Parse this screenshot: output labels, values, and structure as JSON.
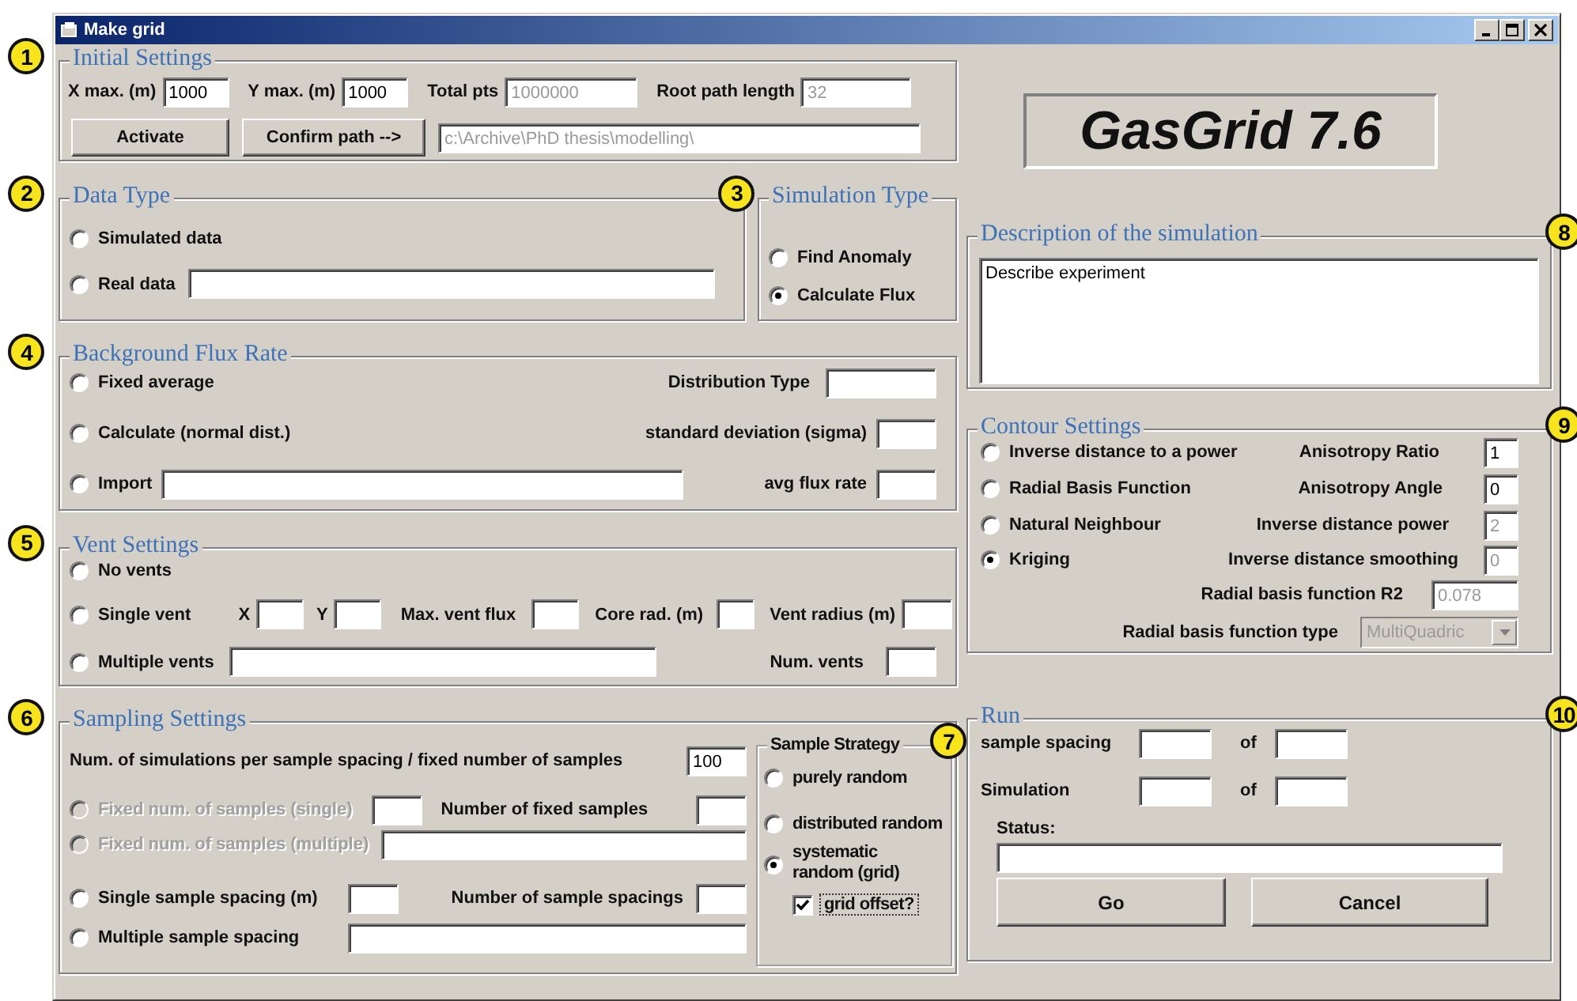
{
  "window": {
    "title": "Make grid"
  },
  "initial_settings": {
    "callout": "1",
    "title": "Initial Settings",
    "fields": [
      {
        "kind": "label",
        "text": "X max. (m)"
      },
      {
        "kind": "field",
        "value": "1000",
        "disabled": false
      },
      {
        "kind": "label",
        "text": "Y max. (m)"
      },
      {
        "kind": "field",
        "value": "1000",
        "disabled": false
      },
      {
        "kind": "label",
        "text": "Total pts"
      },
      {
        "kind": "field",
        "value": "1000000",
        "disabled": true
      },
      {
        "kind": "label",
        "text": "Root path length"
      },
      {
        "kind": "field",
        "value": "32",
        "disabled": true
      }
    ],
    "actions": [
      {
        "kind": "button",
        "label": "Activate"
      },
      {
        "kind": "button",
        "label": "Confirm path -->"
      },
      {
        "kind": "field",
        "value": "c:\\Archive\\PhD thesis\\modelling\\",
        "disabled": true
      }
    ]
  },
  "data_type": {
    "callout": "2",
    "title": "Data Type",
    "rows": [
      [
        {
          "kind": "radio",
          "label": "Simulated data",
          "selected": false,
          "disabled": false
        }
      ],
      [
        {
          "kind": "radio",
          "label": "Real data",
          "selected": false,
          "disabled": false
        },
        {
          "kind": "field"
        }
      ]
    ]
  },
  "simulation_type": {
    "callout": "3",
    "title": "Simulation Type",
    "rows": [
      [
        {
          "kind": "radio",
          "label": "Find Anomaly",
          "selected": false,
          "disabled": false
        }
      ],
      [
        {
          "kind": "radio",
          "label": "Calculate Flux",
          "selected": true,
          "disabled": false
        }
      ]
    ]
  },
  "background_flux_rate": {
    "callout": "4",
    "title": "Background Flux Rate",
    "rows": [
      [
        {
          "kind": "radio",
          "label": "Fixed average",
          "selected": false,
          "disabled": false
        },
        {
          "kind": "label",
          "text": "Distribution Type"
        },
        {
          "kind": "field"
        }
      ],
      [
        {
          "kind": "radio",
          "label": "Calculate (normal dist.)",
          "selected": false,
          "disabled": false
        },
        {
          "kind": "label",
          "text": "standard deviation (sigma)"
        },
        {
          "kind": "field"
        }
      ],
      [
        {
          "kind": "radio",
          "label": "Import",
          "selected": false,
          "disabled": false
        },
        {
          "kind": "field"
        },
        {
          "kind": "label",
          "text": "avg flux rate"
        },
        {
          "kind": "field"
        }
      ]
    ]
  },
  "vent_settings": {
    "callout": "5",
    "title": "Vent Settings",
    "rows": [
      [
        {
          "kind": "radio",
          "label": "No vents",
          "selected": false,
          "disabled": false
        }
      ],
      [
        {
          "kind": "radio",
          "label": "Single vent",
          "selected": false,
          "disabled": false
        },
        {
          "kind": "label",
          "text": "X"
        },
        {
          "kind": "field"
        },
        {
          "kind": "label",
          "text": "Y"
        },
        {
          "kind": "field"
        },
        {
          "kind": "label",
          "text": "Max. vent flux"
        },
        {
          "kind": "field"
        },
        {
          "kind": "label",
          "text": "Core rad. (m)"
        },
        {
          "kind": "field"
        },
        {
          "kind": "label",
          "text": "Vent radius (m)"
        },
        {
          "kind": "field"
        }
      ],
      [
        {
          "kind": "radio",
          "label": "Multiple vents",
          "selected": false,
          "disabled": false
        },
        {
          "kind": "field"
        },
        {
          "kind": "label",
          "text": "Num. vents"
        },
        {
          "kind": "field"
        }
      ]
    ]
  },
  "sampling_settings": {
    "callout": "6",
    "title": "Sampling Settings",
    "rows": [
      [
        {
          "kind": "label",
          "text": "Num. of simulations per sample spacing / fixed number of samples"
        },
        {
          "kind": "field",
          "value": "100",
          "disabled": false
        }
      ],
      [
        {
          "kind": "radio",
          "label": "Fixed num. of samples (single)",
          "selected": false,
          "disabled": true
        },
        {
          "kind": "field"
        },
        {
          "kind": "label",
          "text": "Number of fixed samples"
        },
        {
          "kind": "field"
        }
      ],
      [
        {
          "kind": "radio",
          "label": "Fixed num. of samples (multiple)",
          "selected": false,
          "disabled": true
        },
        {
          "kind": "field"
        }
      ],
      [
        {
          "kind": "radio",
          "label": "Single sample spacing (m)",
          "selected": false,
          "disabled": false
        },
        {
          "kind": "field"
        },
        {
          "kind": "label",
          "text": "Number of sample spacings"
        },
        {
          "kind": "field"
        }
      ],
      [
        {
          "kind": "radio",
          "label": "Multiple sample spacing",
          "selected": false,
          "disabled": false
        },
        {
          "kind": "field"
        }
      ]
    ],
    "sample_strategy": {
      "callout": "7",
      "title": "Sample Strategy",
      "rows": [
        [
          {
            "kind": "radio",
            "label": "purely random",
            "selected": false,
            "disabled": false
          }
        ],
        [
          {
            "kind": "radio",
            "label": "distributed random",
            "selected": false,
            "disabled": false
          }
        ],
        [
          {
            "kind": "radio",
            "label": "systematic random (grid)",
            "selected": true,
            "disabled": false
          }
        ],
        [
          {
            "kind": "checkbox",
            "label": "grid offset?",
            "checked": true
          }
        ]
      ]
    }
  },
  "logo": "GasGrid 7.6",
  "description": {
    "callout": "8",
    "title": "Description of the simulation",
    "rows": [
      [
        {
          "kind": "textarea",
          "value": "Describe experiment",
          "disabled": false
        }
      ]
    ]
  },
  "contour_settings": {
    "callout": "9",
    "title": "Contour Settings",
    "rows": [
      [
        {
          "kind": "radio",
          "label": "Inverse distance to a power",
          "selected": false,
          "disabled": false
        },
        {
          "kind": "label",
          "text": "Anisotropy Ratio"
        },
        {
          "kind": "field",
          "value": "1",
          "disabled": false
        }
      ],
      [
        {
          "kind": "radio",
          "label": "Radial Basis Function",
          "selected": false,
          "disabled": false
        },
        {
          "kind": "label",
          "text": "Anisotropy Angle"
        },
        {
          "kind": "field",
          "value": "0",
          "disabled": false
        }
      ],
      [
        {
          "kind": "radio",
          "label": "Natural Neighbour",
          "selected": false,
          "disabled": false
        },
        {
          "kind": "label",
          "text": "Inverse distance power"
        },
        {
          "kind": "field",
          "value": "2",
          "disabled": true
        }
      ],
      [
        {
          "kind": "radio",
          "label": "Kriging",
          "selected": true,
          "disabled": false
        },
        {
          "kind": "label",
          "text": "Inverse distance smoothing"
        },
        {
          "kind": "field",
          "value": "0",
          "disabled": true
        }
      ],
      [
        {
          "kind": "label",
          "text": "Radial basis function R2"
        },
        {
          "kind": "field",
          "value": "0.078",
          "disabled": true
        }
      ],
      [
        {
          "kind": "label",
          "text": "Radial basis function type"
        },
        {
          "kind": "select",
          "value": "MultiQuadric",
          "disabled": true
        }
      ]
    ]
  },
  "run": {
    "callout": "10",
    "title": "Run",
    "rows": [
      [
        {
          "kind": "label",
          "text": "sample spacing"
        },
        {
          "kind": "field"
        },
        {
          "kind": "label",
          "text": "of"
        },
        {
          "kind": "field"
        }
      ],
      [
        {
          "kind": "label",
          "text": "Simulation"
        },
        {
          "kind": "field"
        },
        {
          "kind": "label",
          "text": "of"
        },
        {
          "kind": "field"
        }
      ],
      [
        {
          "kind": "label",
          "text": "Status:"
        }
      ],
      [
        {
          "kind": "field"
        }
      ],
      [
        {
          "kind": "button",
          "label": "Go"
        },
        {
          "kind": "button",
          "label": "Cancel"
        }
      ]
    ]
  }
}
